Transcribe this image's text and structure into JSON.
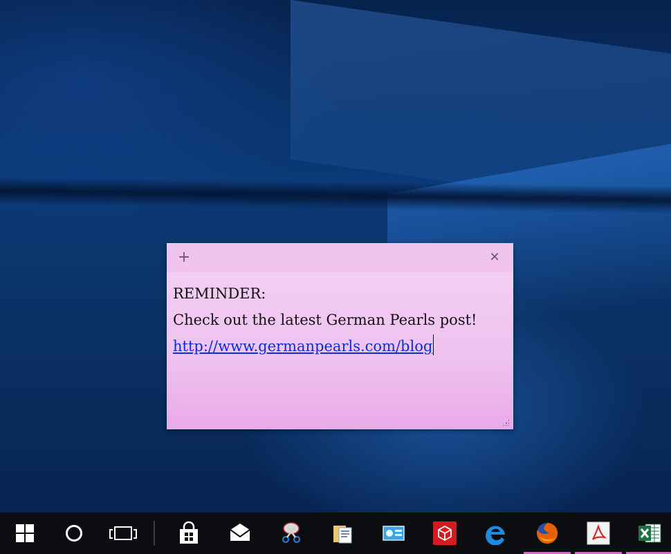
{
  "sticky_note": {
    "add_label": "+",
    "close_label": "✕",
    "lines": [
      "REMINDER:",
      "Check out the latest German Pearls post!"
    ],
    "link": "http://www.germanpearls.com/blog"
  },
  "taskbar": {
    "items": [
      {
        "name": "start",
        "icon": "windows-logo-icon"
      },
      {
        "name": "cortana",
        "icon": "cortana-circle-icon"
      },
      {
        "name": "task-view",
        "icon": "task-view-icon"
      },
      {
        "name": "store",
        "icon": "store-bag-icon"
      },
      {
        "name": "mail",
        "icon": "mail-envelope-icon"
      },
      {
        "name": "snipping-tool",
        "icon": "scissors-icon"
      },
      {
        "name": "file-explorer",
        "icon": "folder-icon"
      },
      {
        "name": "control-panel",
        "icon": "control-panel-icon"
      },
      {
        "name": "3d-builder",
        "icon": "red-cube-icon"
      },
      {
        "name": "edge",
        "icon": "edge-e-icon"
      },
      {
        "name": "firefox",
        "icon": "firefox-icon",
        "active": true
      },
      {
        "name": "acrobat",
        "icon": "pdf-icon",
        "active": true
      },
      {
        "name": "excel",
        "icon": "excel-icon",
        "active": true
      }
    ],
    "active_color": "#e55fd9"
  },
  "colors": {
    "sticky_body": "#f5d3f5",
    "sticky_titlebar": "#f1c3ef",
    "link": "#0b2fd0",
    "taskbar": "#0c0d10"
  }
}
